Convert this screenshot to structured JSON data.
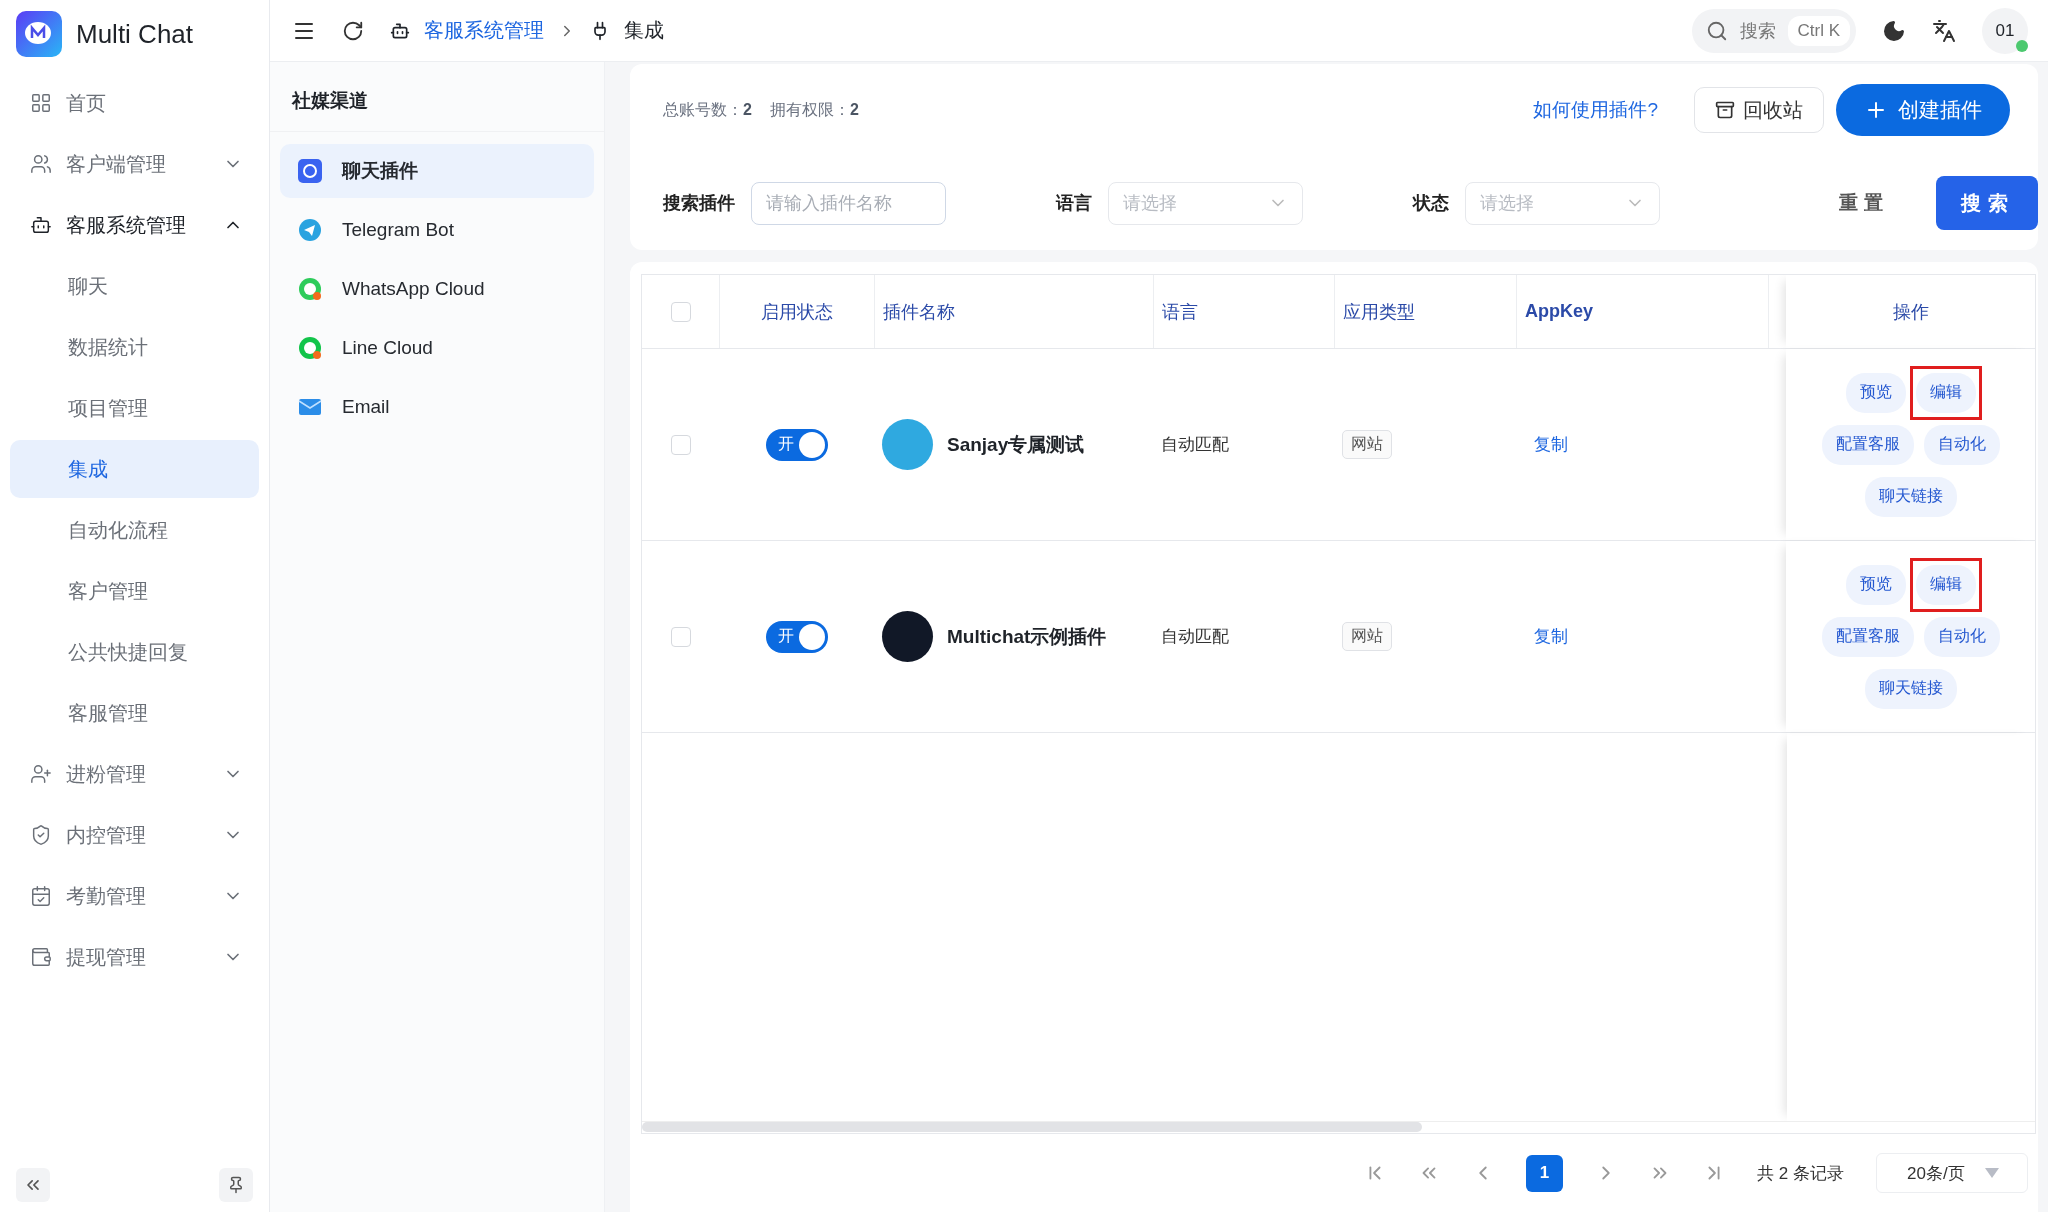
{
  "app": {
    "name": "Multi Chat"
  },
  "sidebar": {
    "items": [
      {
        "label": "首页",
        "selected": false
      },
      {
        "label": "客户端管理",
        "expanded": false
      },
      {
        "label": "客服系统管理",
        "expanded": true,
        "children": [
          {
            "label": "聊天",
            "selected": false
          },
          {
            "label": "数据统计",
            "selected": false
          },
          {
            "label": "项目管理",
            "selected": false
          },
          {
            "label": "集成",
            "selected": true
          },
          {
            "label": "自动化流程",
            "selected": false
          },
          {
            "label": "客户管理",
            "selected": false
          },
          {
            "label": "公共快捷回复",
            "selected": false
          },
          {
            "label": "客服管理",
            "selected": false
          }
        ]
      },
      {
        "label": "进粉管理",
        "expanded": false
      },
      {
        "label": "内控管理",
        "expanded": false
      },
      {
        "label": "考勤管理",
        "expanded": false
      },
      {
        "label": "提现管理",
        "expanded": false
      }
    ]
  },
  "header": {
    "breadcrumb": [
      {
        "label": "客服系统管理"
      },
      {
        "label": "集成"
      }
    ],
    "search": {
      "placeholder": "搜索",
      "shortcut": "Ctrl K"
    },
    "avatar": {
      "label": "01",
      "online": true
    }
  },
  "channels": {
    "title": "社媒渠道",
    "items": [
      {
        "label": "聊天插件",
        "selected": true
      },
      {
        "label": "Telegram Bot",
        "selected": false
      },
      {
        "label": "WhatsApp Cloud",
        "selected": false
      },
      {
        "label": "Line Cloud",
        "selected": false
      },
      {
        "label": "Email",
        "selected": false
      }
    ]
  },
  "toolbar": {
    "stats": [
      "总账号数：**2**",
      "拥有权限：**2**"
    ],
    "help_link": "如何使用插件?",
    "recycle_button": "回收站",
    "create_button": "创建插件"
  },
  "filters": [
    {
      "label": "搜索插件",
      "kind": "input",
      "placeholder": "请输入插件名称"
    },
    {
      "label": "语言",
      "kind": "select",
      "placeholder": "请选择"
    },
    {
      "label": "状态",
      "kind": "select",
      "placeholder": "请选择"
    }
  ],
  "filter_buttons": {
    "reset": "重置",
    "search": "搜索"
  },
  "table": {
    "columns": [
      "启用状态",
      "插件名称",
      "语言",
      "应用类型",
      "AppKey"
    ],
    "actions_header": "操作",
    "all_selected": false,
    "rows": [
      {
        "selected": false,
        "enabled": true,
        "toggle_label": "开",
        "name": "Sanjay专属测试",
        "color": "#2fa9e0",
        "language": "自动匹配",
        "app_type": "网站",
        "appkey": "复制",
        "actions": [
          {
            "label": "预览",
            "highlighted": false
          },
          {
            "label": "编辑",
            "highlighted": true
          },
          {
            "label": "配置客服",
            "highlighted": false
          },
          {
            "label": "自动化",
            "highlighted": false
          },
          {
            "label": "聊天链接",
            "highlighted": false
          }
        ]
      },
      {
        "selected": false,
        "enabled": true,
        "toggle_label": "开",
        "name": "Multichat示例插件",
        "color": "#111827",
        "language": "自动匹配",
        "app_type": "网站",
        "appkey": "复制",
        "actions": [
          {
            "label": "预览",
            "highlighted": false
          },
          {
            "label": "编辑",
            "highlighted": true
          },
          {
            "label": "配置客服",
            "highlighted": false
          },
          {
            "label": "自动化",
            "highlighted": false
          },
          {
            "label": "聊天链接",
            "highlighted": false
          }
        ]
      }
    ]
  },
  "pagination": {
    "pages": [
      {
        "label": "1",
        "selected": true
      }
    ],
    "total": "共 2 条记录",
    "page_size": "20条/页"
  }
}
